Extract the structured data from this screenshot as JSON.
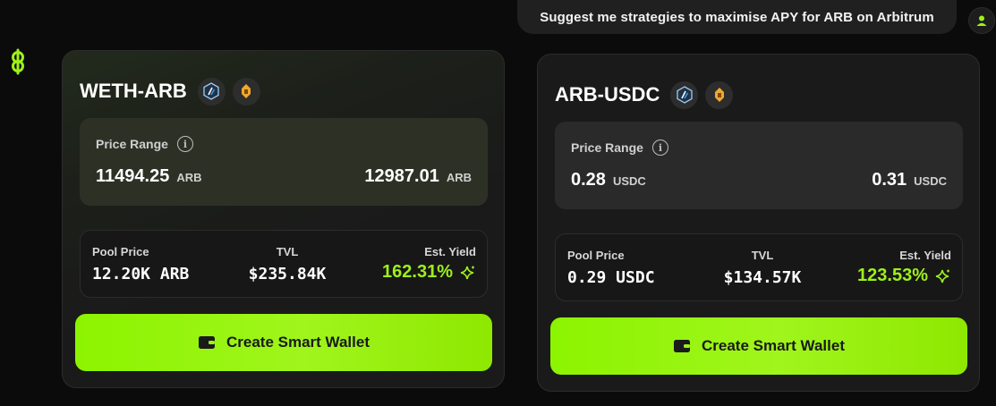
{
  "chat": {
    "user_message": "Suggest me strategies to maximise APY for ARB on Arbitrum"
  },
  "colors": {
    "accent": "#9ef01a",
    "yield_left": "#9ef01a",
    "yield_right": "#9ef01a"
  },
  "cards": [
    {
      "pair": "WETH-ARB",
      "icons": [
        "arbitrum-icon",
        "camelot-icon"
      ],
      "range_label": "Price Range",
      "range_min": "11494.25",
      "range_min_unit": "ARB",
      "range_max": "12987.01",
      "range_max_unit": "ARB",
      "pool_price_label": "Pool Price",
      "pool_price_value": "12.20K ARB",
      "tvl_label": "TVL",
      "tvl_value": "$235.84K",
      "yield_label": "Est. Yield",
      "yield_value": "162.31%",
      "cta_label": "Create Smart Wallet"
    },
    {
      "pair": "ARB-USDC",
      "icons": [
        "arbitrum-icon",
        "camelot-icon"
      ],
      "range_label": "Price Range",
      "range_min": "0.28",
      "range_min_unit": "USDC",
      "range_max": "0.31",
      "range_max_unit": "USDC",
      "pool_price_label": "Pool Price",
      "pool_price_value": "0.29 USDC",
      "tvl_label": "TVL",
      "tvl_value": "$134.57K",
      "yield_label": "Est. Yield",
      "yield_value": "123.53%",
      "cta_label": "Create Smart Wallet"
    }
  ]
}
